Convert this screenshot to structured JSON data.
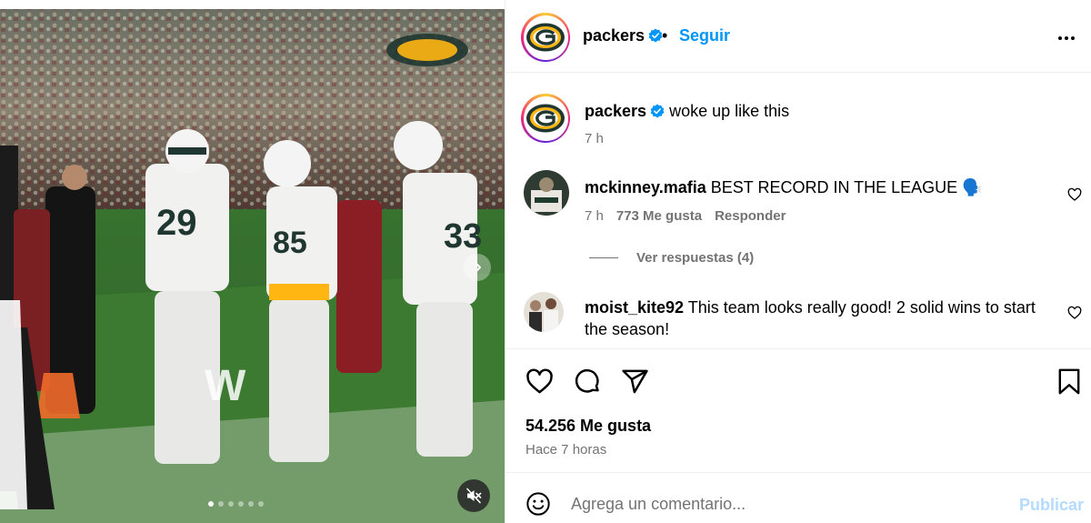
{
  "colors": {
    "accent": "#0095f6",
    "text": "#000000",
    "muted": "#737373",
    "publish_disabled": "#b3dbff",
    "packers_green": "#203731",
    "packers_gold": "#ffb612"
  },
  "media": {
    "jersey_numbers": [
      "29",
      "85",
      "33"
    ],
    "carousel_dots": 6,
    "carousel_active_index": 0,
    "icons": {
      "next": "chevron-right-icon",
      "mute": "speaker-muted-icon"
    }
  },
  "header": {
    "username": "packers",
    "separator": "•",
    "follow_label": "Seguir",
    "more_icon": "more-horizontal-icon"
  },
  "caption": {
    "username": "packers",
    "text": "woke up like this",
    "time": "7 h"
  },
  "comments": [
    {
      "username": "mckinney.mafia",
      "text": "BEST RECORD IN THE LEAGUE 🗣️",
      "time": "7 h",
      "likes": "773 Me gusta",
      "reply_label": "Responder"
    },
    {
      "username": "moist_kite92",
      "text": "This team looks really good! 2 solid wins to start the season!"
    }
  ],
  "view_replies": "Ver respuestas (4)",
  "actions": {
    "icons": [
      "heart-icon",
      "comment-icon",
      "share-icon",
      "bookmark-icon"
    ]
  },
  "likes_count": "54.256 Me gusta",
  "posted_ago": "Hace 7 horas",
  "composer": {
    "placeholder": "Agrega un comentario...",
    "publish_label": "Publicar"
  }
}
